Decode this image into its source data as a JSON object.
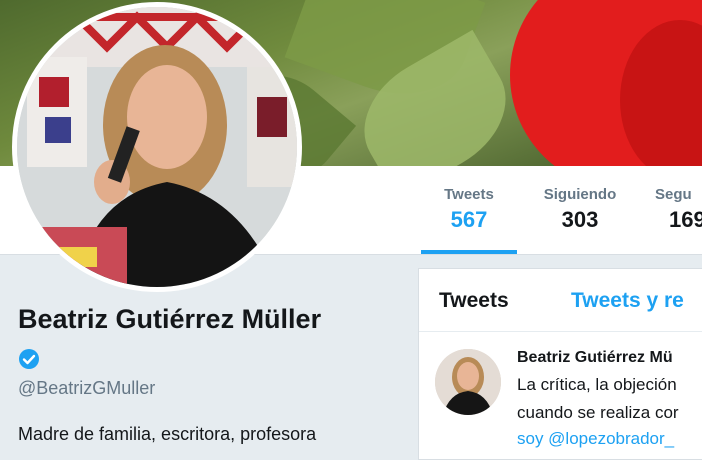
{
  "profile": {
    "name": "Beatriz Gutiérrez Müller",
    "handle": "@BeatrizGMuller",
    "bio": "Madre de familia, escritora, profesora",
    "verified_icon": "verified-badge-icon"
  },
  "stats": [
    {
      "label": "Tweets",
      "value": "567"
    },
    {
      "label": "Siguiendo",
      "value": "303"
    },
    {
      "label": "Segu",
      "value": "169"
    }
  ],
  "timeline": {
    "tabs": [
      "Tweets",
      "Tweets y re"
    ],
    "tweet": {
      "author": "Beatriz Gutiérrez Mü",
      "lines": [
        "La crítica, la objeción",
        "cuando se realiza cor",
        "soy @lopezobrador_"
      ]
    }
  },
  "colors": {
    "accent": "#1da1f2",
    "background": "#e6ecf0",
    "text": "#14171a",
    "muted": "#657786"
  }
}
